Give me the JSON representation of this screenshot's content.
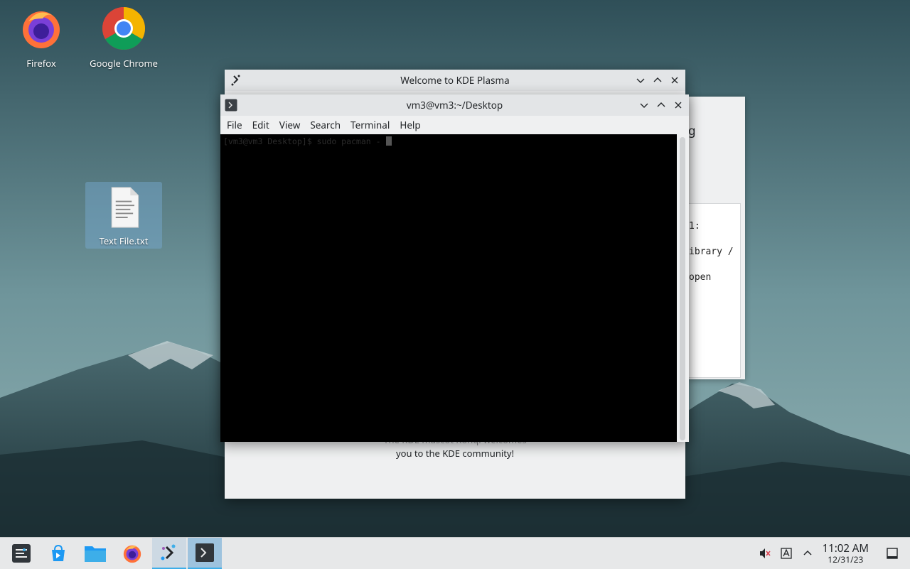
{
  "desktop": {
    "icons": [
      {
        "label": "Firefox",
        "icon": "firefox-icon"
      },
      {
        "label": "Google Chrome",
        "icon": "chrome-icon"
      },
      {
        "label": "Text File.txt",
        "icon": "text-file-icon"
      }
    ]
  },
  "welcome_window": {
    "title": "Welcome to KDE Plasma",
    "partial_heading": "g",
    "side_card_lines": [
      "1:",
      "ibrary /",
      "open"
    ],
    "footer_line1": "The KDE mascot Konqi welcomes",
    "footer_line2": "you to the KDE community!"
  },
  "terminal_window": {
    "title": "vm3@vm3:~/Desktop",
    "menu": [
      "File",
      "Edit",
      "View",
      "Search",
      "Terminal",
      "Help"
    ],
    "prompt_line": "[vm3@vm3 Desktop]$ sudo pacman -",
    "background": "#000000"
  },
  "taskbar": {
    "apps": [
      {
        "name": "application-launcher",
        "icon": "launcher-icon"
      },
      {
        "name": "discover",
        "icon": "discover-icon"
      },
      {
        "name": "dolphin",
        "icon": "folder-icon"
      },
      {
        "name": "firefox",
        "icon": "firefox-icon"
      },
      {
        "name": "welcome",
        "icon": "kde-welcome-icon"
      },
      {
        "name": "konsole",
        "icon": "terminal-icon"
      }
    ],
    "tray": [
      "muted-volume-icon",
      "keyboard-layout-icon",
      "chevron-up-icon",
      "show-desktop-icon"
    ],
    "clock_time": "11:02 AM",
    "clock_date": "12/31/23"
  },
  "colors": {
    "accent": "#3daee9",
    "titlebar": "#e3e5e7",
    "window_bg": "#eff0f1"
  }
}
